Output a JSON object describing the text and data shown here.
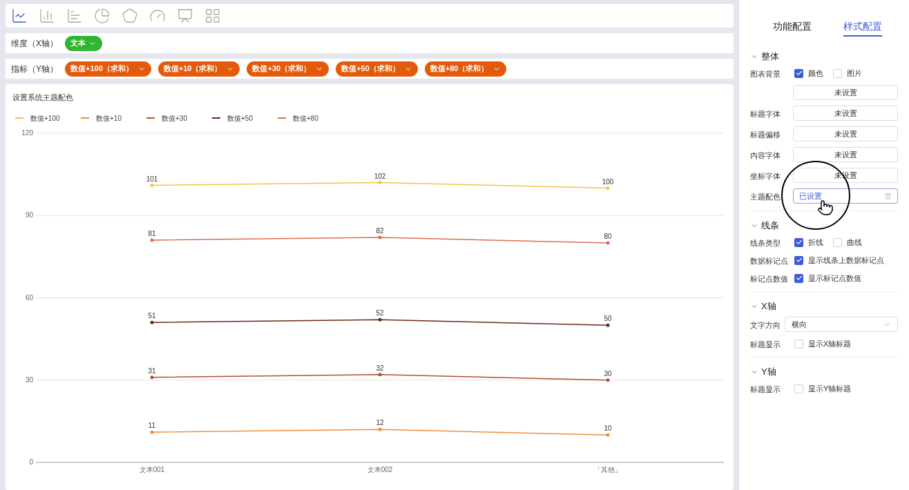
{
  "chart_types": [
    {
      "kind": "line",
      "selected": true
    },
    {
      "kind": "column",
      "selected": false
    },
    {
      "kind": "bar",
      "selected": false
    },
    {
      "kind": "pie",
      "selected": false
    },
    {
      "kind": "radar",
      "selected": false
    },
    {
      "kind": "gauge",
      "selected": false
    },
    {
      "kind": "board",
      "selected": false
    },
    {
      "kind": "table",
      "selected": false
    }
  ],
  "dimension": {
    "label": "维度（X轴）",
    "chips": [
      "文本"
    ]
  },
  "metric": {
    "label": "指标（Y轴）",
    "chips": [
      "数值+100（求和）",
      "数值+10（求和）",
      "数值+30（求和）",
      "数值+50（求和）",
      "数值+80（求和）"
    ]
  },
  "chart": {
    "title": "设置系统主题配色",
    "chart_data": {
      "type": "line",
      "categories": [
        "文本001",
        "文本002",
        "「其他」"
      ],
      "ylim": [
        0,
        120
      ],
      "yticks": [
        0,
        30,
        60,
        90,
        120
      ],
      "data_labels": true,
      "grid": true,
      "series": [
        {
          "name": "数值+100",
          "color": "#f5c445",
          "values": [
            101,
            102,
            100
          ]
        },
        {
          "name": "数值+10",
          "color": "#ef8f3a",
          "values": [
            11,
            12,
            10
          ]
        },
        {
          "name": "数值+30",
          "color": "#b4502a",
          "values": [
            31,
            32,
            30
          ]
        },
        {
          "name": "数值+50",
          "color": "#6a2817",
          "values": [
            51,
            52,
            50
          ]
        },
        {
          "name": "数值+80",
          "color": "#df6d4c",
          "values": [
            81,
            82,
            80
          ]
        }
      ]
    }
  },
  "panel": {
    "tabs": [
      {
        "label": "功能配置",
        "selected": false
      },
      {
        "label": "样式配置",
        "selected": true
      }
    ],
    "sections": [
      {
        "title": "整体",
        "expanded": true,
        "rows": [
          {
            "kind": "checks",
            "label": "图表背景",
            "options": [
              {
                "label": "颜色",
                "checked": true
              },
              {
                "label": "图片",
                "checked": false
              }
            ]
          },
          {
            "kind": "button",
            "value": "未设置",
            "set": false
          },
          {
            "kind": "button",
            "label": "标题字体",
            "value": "未设置",
            "set": false
          },
          {
            "kind": "button",
            "label": "标题偏移",
            "value": "未设置",
            "set": false
          },
          {
            "kind": "button",
            "label": "内容字体",
            "value": "未设置",
            "set": false
          },
          {
            "kind": "button",
            "label": "坐标字体",
            "value": "未设置",
            "set": false
          },
          {
            "kind": "button",
            "label": "主题配色",
            "value": "已设置",
            "set": true
          }
        ]
      },
      {
        "title": "线条",
        "expanded": true,
        "rows": [
          {
            "kind": "checks",
            "label": "线条类型",
            "options": [
              {
                "label": "折线",
                "checked": true
              },
              {
                "label": "曲线",
                "checked": false
              }
            ]
          },
          {
            "kind": "checks",
            "label": "数据标记点",
            "options": [
              {
                "label": "显示线条上数据标记点",
                "checked": true
              }
            ]
          },
          {
            "kind": "checks",
            "label": "标记点数值",
            "options": [
              {
                "label": "显示标记点数值",
                "checked": true
              }
            ]
          }
        ]
      },
      {
        "title": "X轴",
        "expanded": true,
        "rows": [
          {
            "kind": "select",
            "label": "文字方向",
            "value": "横向"
          },
          {
            "kind": "checks",
            "label": "标题显示",
            "options": [
              {
                "label": "显示X轴标题",
                "checked": false
              }
            ]
          }
        ]
      },
      {
        "title": "Y轴",
        "expanded": true,
        "rows": [
          {
            "kind": "checks",
            "label": "标题显示",
            "options": [
              {
                "label": "显示Y轴标题",
                "checked": false
              }
            ]
          }
        ]
      }
    ]
  }
}
